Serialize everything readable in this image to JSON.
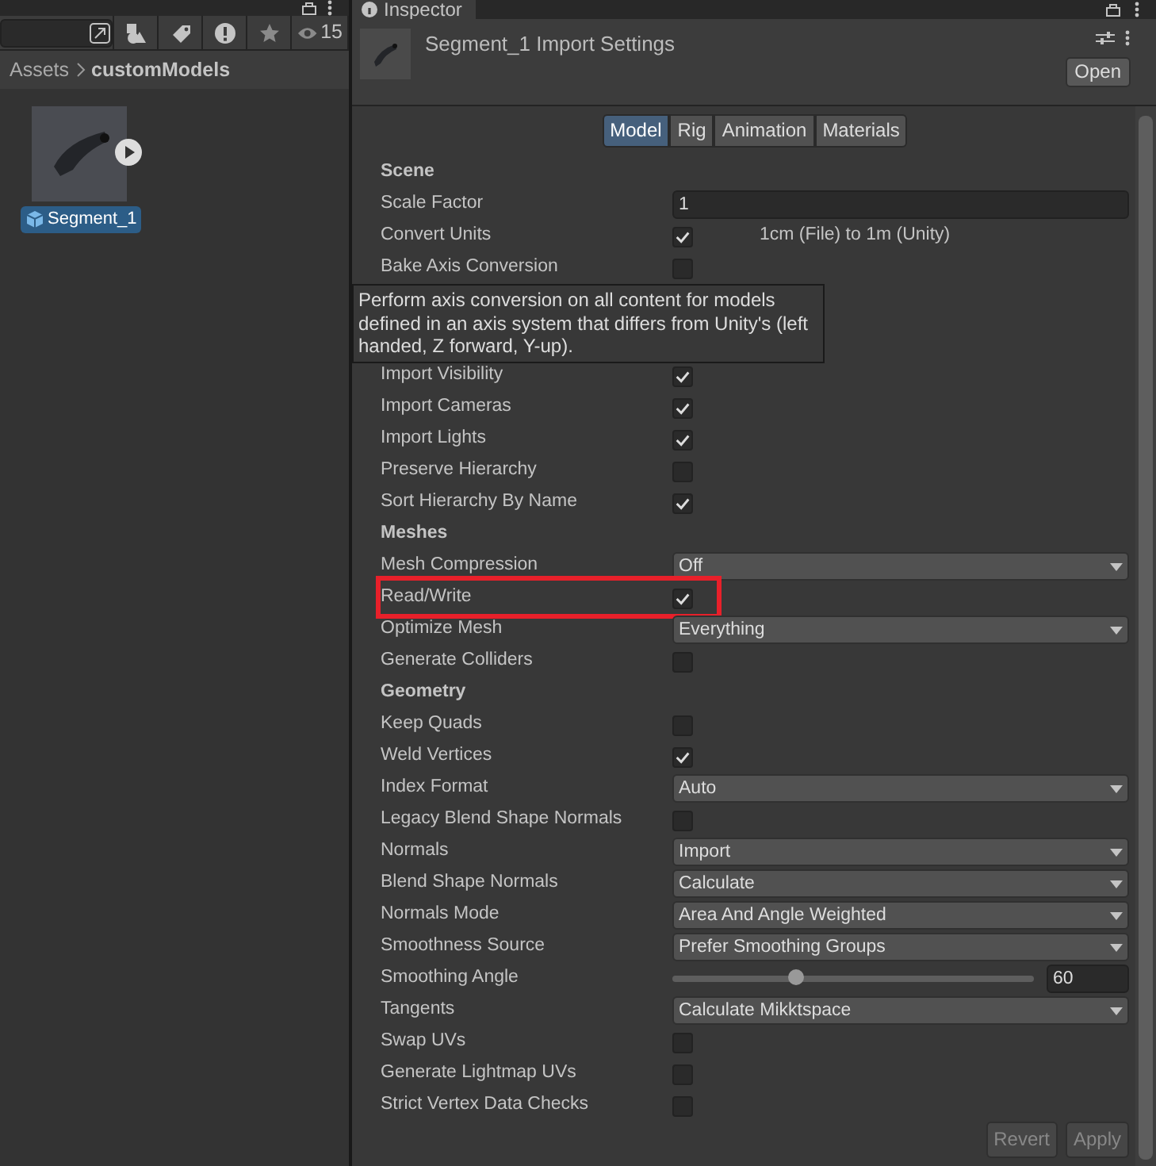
{
  "project": {
    "hidden_count": "15",
    "breadcrumb": [
      "Assets",
      "customModels"
    ],
    "asset": {
      "name": "Segment_1",
      "selected": true
    }
  },
  "inspector": {
    "tab": "Inspector",
    "title": "Segment_1 Import Settings",
    "open_button": "Open",
    "tabs": [
      {
        "label": "Model",
        "selected": true
      },
      {
        "label": "Rig",
        "selected": false
      },
      {
        "label": "Animation",
        "selected": false
      },
      {
        "label": "Materials",
        "selected": false
      }
    ],
    "rows": [
      {
        "kind": "header",
        "label": "Scene"
      },
      {
        "kind": "text",
        "label": "Scale Factor",
        "value": "1"
      },
      {
        "kind": "checkbox",
        "label": "Convert Units",
        "checked": true,
        "note": "1cm (File) to 1m (Unity)"
      },
      {
        "kind": "checkbox",
        "label": "Bake Axis Conversion",
        "checked": false
      },
      {
        "kind": "tooltip",
        "text": "Perform axis conversion on all content for models defined in an axis system that differs from Unity's (left handed, Z forward, Y-up)."
      },
      {
        "kind": "checkbox",
        "label": "Import Visibility",
        "checked": true
      },
      {
        "kind": "checkbox",
        "label": "Import Cameras",
        "checked": true
      },
      {
        "kind": "checkbox",
        "label": "Import Lights",
        "checked": true
      },
      {
        "kind": "checkbox",
        "label": "Preserve Hierarchy",
        "checked": false
      },
      {
        "kind": "checkbox",
        "label": "Sort Hierarchy By Name",
        "checked": true
      },
      {
        "kind": "header",
        "label": "Meshes"
      },
      {
        "kind": "dropdown",
        "label": "Mesh Compression",
        "value": "Off"
      },
      {
        "kind": "checkbox",
        "label": "Read/Write",
        "checked": true,
        "highlighted": true
      },
      {
        "kind": "dropdown",
        "label": "Optimize Mesh",
        "value": "Everything"
      },
      {
        "kind": "checkbox",
        "label": "Generate Colliders",
        "checked": false
      },
      {
        "kind": "header",
        "label": "Geometry"
      },
      {
        "kind": "checkbox",
        "label": "Keep Quads",
        "checked": false
      },
      {
        "kind": "checkbox",
        "label": "Weld Vertices",
        "checked": true
      },
      {
        "kind": "dropdown",
        "label": "Index Format",
        "value": "Auto"
      },
      {
        "kind": "checkbox",
        "label": "Legacy Blend Shape Normals",
        "checked": false
      },
      {
        "kind": "dropdown",
        "label": "Normals",
        "value": "Import"
      },
      {
        "kind": "dropdown",
        "label": "Blend Shape Normals",
        "value": "Calculate"
      },
      {
        "kind": "dropdown",
        "label": "Normals Mode",
        "value": "Area And Angle Weighted"
      },
      {
        "kind": "dropdown",
        "label": "Smoothness Source",
        "value": "Prefer Smoothing Groups"
      },
      {
        "kind": "slider",
        "label": "Smoothing Angle",
        "level": 0.34,
        "value": "60"
      },
      {
        "kind": "dropdown",
        "label": "Tangents",
        "value": "Calculate Mikktspace"
      },
      {
        "kind": "checkbox",
        "label": "Swap UVs",
        "checked": false
      },
      {
        "kind": "checkbox",
        "label": "Generate Lightmap UVs",
        "checked": false
      },
      {
        "kind": "checkbox",
        "label": "Strict Vertex Data Checks",
        "checked": false
      }
    ],
    "buttons": [
      "Revert",
      "Apply"
    ]
  }
}
